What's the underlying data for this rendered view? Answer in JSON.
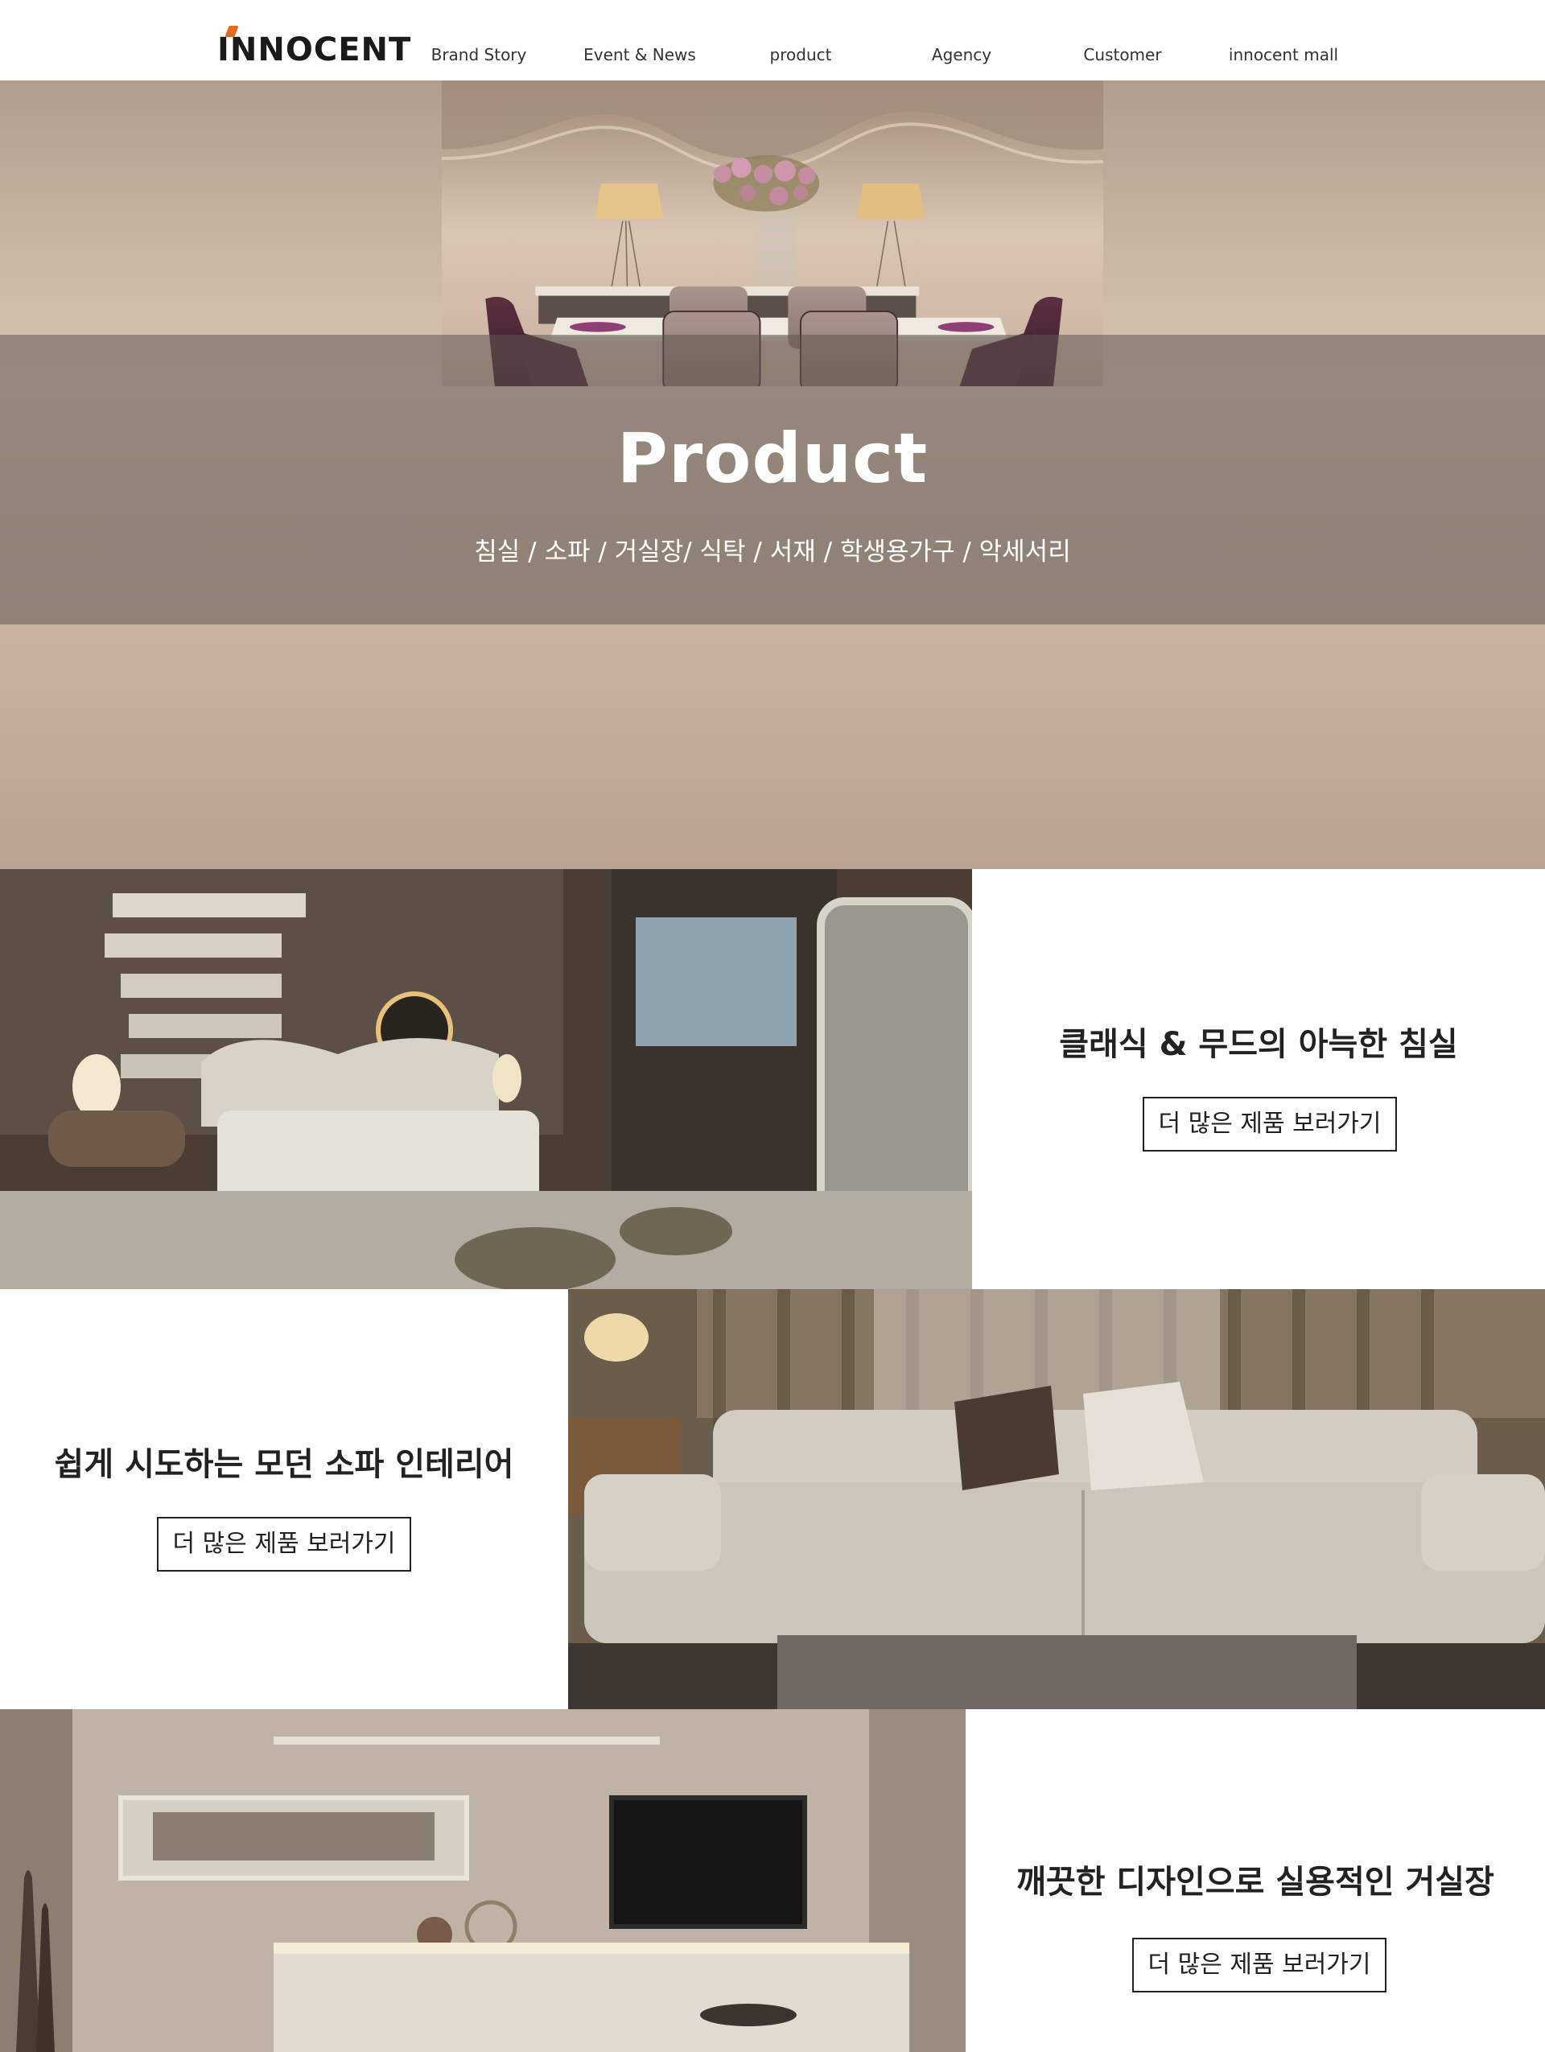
{
  "header": {
    "logo": "INNOCENT",
    "nav": [
      "Brand Story",
      "Event & News",
      "product",
      "Agency",
      "Customer",
      "innocent mall"
    ]
  },
  "hero": {
    "title": "Product",
    "subtitle": "침실 / 소파 / 거실장/ 식탁 / 서재 / 학생용가구 / 악세서리"
  },
  "sections": [
    {
      "title": "클래식 & 무드의 아늑한 침실",
      "button": "더 많은 제품 보러가기"
    },
    {
      "title": "쉽게 시도하는 모던 소파 인테리어",
      "button": "더 많은 제품 보러가기"
    },
    {
      "title": "깨끗한 디자인으로 실용적인 거실장",
      "button": "더 많은 제품 보러가기"
    }
  ],
  "colors": {
    "accent": "#e06a1f",
    "text": "#222222",
    "hero_band": "#5f5550"
  }
}
